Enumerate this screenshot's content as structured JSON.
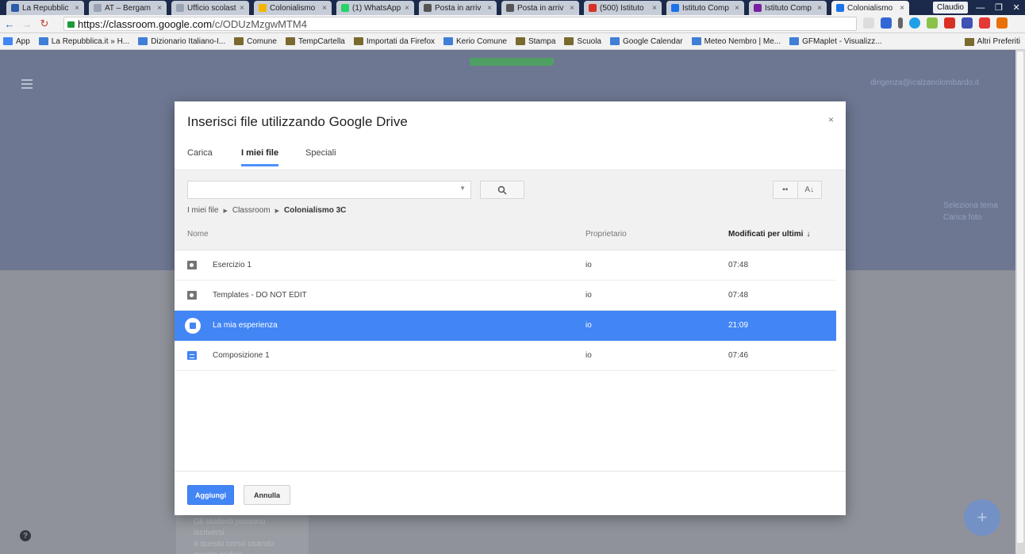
{
  "browser": {
    "tabs": [
      {
        "label": "La Repubblic",
        "color": "#2a5caa"
      },
      {
        "label": "AT – Bergam",
        "color": "#9aa3b2"
      },
      {
        "label": "Ufficio scolast",
        "color": "#9aa3b2"
      },
      {
        "label": "Colonialismo",
        "color": "#f4b400"
      },
      {
        "label": "(1) WhatsApp",
        "color": "#25d366"
      },
      {
        "label": "Posta in arriv",
        "color": "#555"
      },
      {
        "label": "Posta in arriv",
        "color": "#555"
      },
      {
        "label": "(500) Istituto",
        "color": "#d93025"
      },
      {
        "label": "Istituto Comp",
        "color": "#1a73e8"
      },
      {
        "label": "Istituto Comp",
        "color": "#7b1fa2"
      },
      {
        "label": "Colonialismo",
        "color": "#1a73e8"
      }
    ],
    "user": "Claudio",
    "url_host": "https://classroom.google.com",
    "url_path": "/c/ODUzMzgwMTM4",
    "bookmarks": [
      {
        "label": "App",
        "kind": "apps"
      },
      {
        "label": "La Repubblica.it » H...",
        "kind": "site"
      },
      {
        "label": "Dizionario Italiano-I...",
        "kind": "site"
      },
      {
        "label": "Comune",
        "kind": "folder"
      },
      {
        "label": "TempCartella",
        "kind": "folder"
      },
      {
        "label": "Importati da Firefox",
        "kind": "folder"
      },
      {
        "label": "Kerio Comune",
        "kind": "site"
      },
      {
        "label": "Stampa",
        "kind": "folder"
      },
      {
        "label": "Scuola",
        "kind": "folder"
      },
      {
        "label": "Google Calendar",
        "kind": "site"
      },
      {
        "label": "Meteo Nembro | Me...",
        "kind": "site"
      },
      {
        "label": "GFMaplet - Visualizz...",
        "kind": "site"
      }
    ],
    "other_bookmarks": "Altri Preferiti"
  },
  "page": {
    "user_email": "dirigenza@icalzanolombardo.it",
    "theme_links": [
      "Seleziona tema",
      "Carica foto"
    ],
    "behind_card_text": [
      "Gli studenti possono iscriversi",
      "a questo corso usando questo codice"
    ]
  },
  "dialog": {
    "title": "Inserisci file utilizzando Google Drive",
    "close": "×",
    "tabs": [
      "Carica",
      "I miei file",
      "Speciali"
    ],
    "active_tab": "I miei file",
    "search_value": "",
    "breadcrumb": [
      "I miei file",
      "Classroom",
      "Colonialismo 3C"
    ],
    "columns": {
      "name": "Nome",
      "owner": "Proprietario",
      "modified": "Modificati per ultimi"
    },
    "sort_arrow": "↓",
    "files": [
      {
        "name": "Esercizio 1",
        "type": "folder",
        "owner": "io",
        "modified": "07:48",
        "selected": false
      },
      {
        "name": "Templates - DO NOT EDIT",
        "type": "folder",
        "owner": "io",
        "modified": "07:48",
        "selected": false
      },
      {
        "name": "La mia esperienza",
        "type": "doc",
        "owner": "io",
        "modified": "21:09",
        "selected": true
      },
      {
        "name": "Composizione 1",
        "type": "doc",
        "owner": "io",
        "modified": "07:46",
        "selected": false
      }
    ],
    "add_label": "Aggiungi",
    "cancel_label": "Annulla"
  }
}
